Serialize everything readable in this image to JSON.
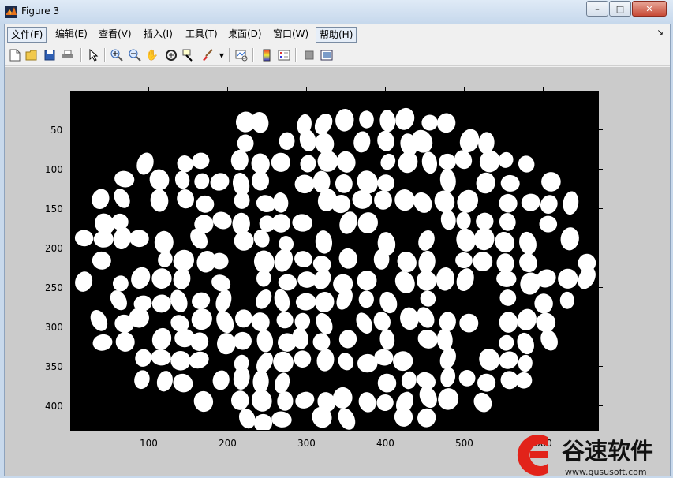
{
  "window": {
    "title": "Figure 3",
    "minimize": "–",
    "maximize": "□",
    "close": "✕"
  },
  "menu": [
    {
      "label": "文件(F)"
    },
    {
      "label": "编辑(E)"
    },
    {
      "label": "查看(V)"
    },
    {
      "label": "插入(I)"
    },
    {
      "label": "工具(T)"
    },
    {
      "label": "桌面(D)"
    },
    {
      "label": "窗口(W)"
    },
    {
      "label": "帮助(H)"
    }
  ],
  "menu_overflow": "↘",
  "toolbar": {
    "new": "new-figure-icon",
    "open": "open-file-icon",
    "save": "save-icon",
    "print": "print-icon",
    "pointer": "edit-plot-icon",
    "zoom_in": "zoom-in-icon",
    "zoom_out": "zoom-out-icon",
    "pan": "pan-icon",
    "rotate": "rotate-3d-icon",
    "datacursor": "data-cursor-icon",
    "brush": "brush-icon",
    "link": "link-plot-icon",
    "colorbar": "colorbar-icon",
    "legend": "legend-icon",
    "hide_tools": "hide-plot-tools-icon",
    "show_tools": "show-plot-tools-icon"
  },
  "axes": {
    "x_ticks": [
      "100",
      "200",
      "300",
      "400",
      "500",
      "600"
    ],
    "y_ticks": [
      "50",
      "100",
      "150",
      "200",
      "250",
      "300",
      "350",
      "400"
    ]
  },
  "watermark": {
    "brand": "谷速软件",
    "url": "www.gususoft.com",
    "accent": "#e2231a"
  },
  "colors": {
    "figure_bg": "#cbcbcb",
    "plot_bg": "#000000",
    "blob": "#ffffff"
  }
}
